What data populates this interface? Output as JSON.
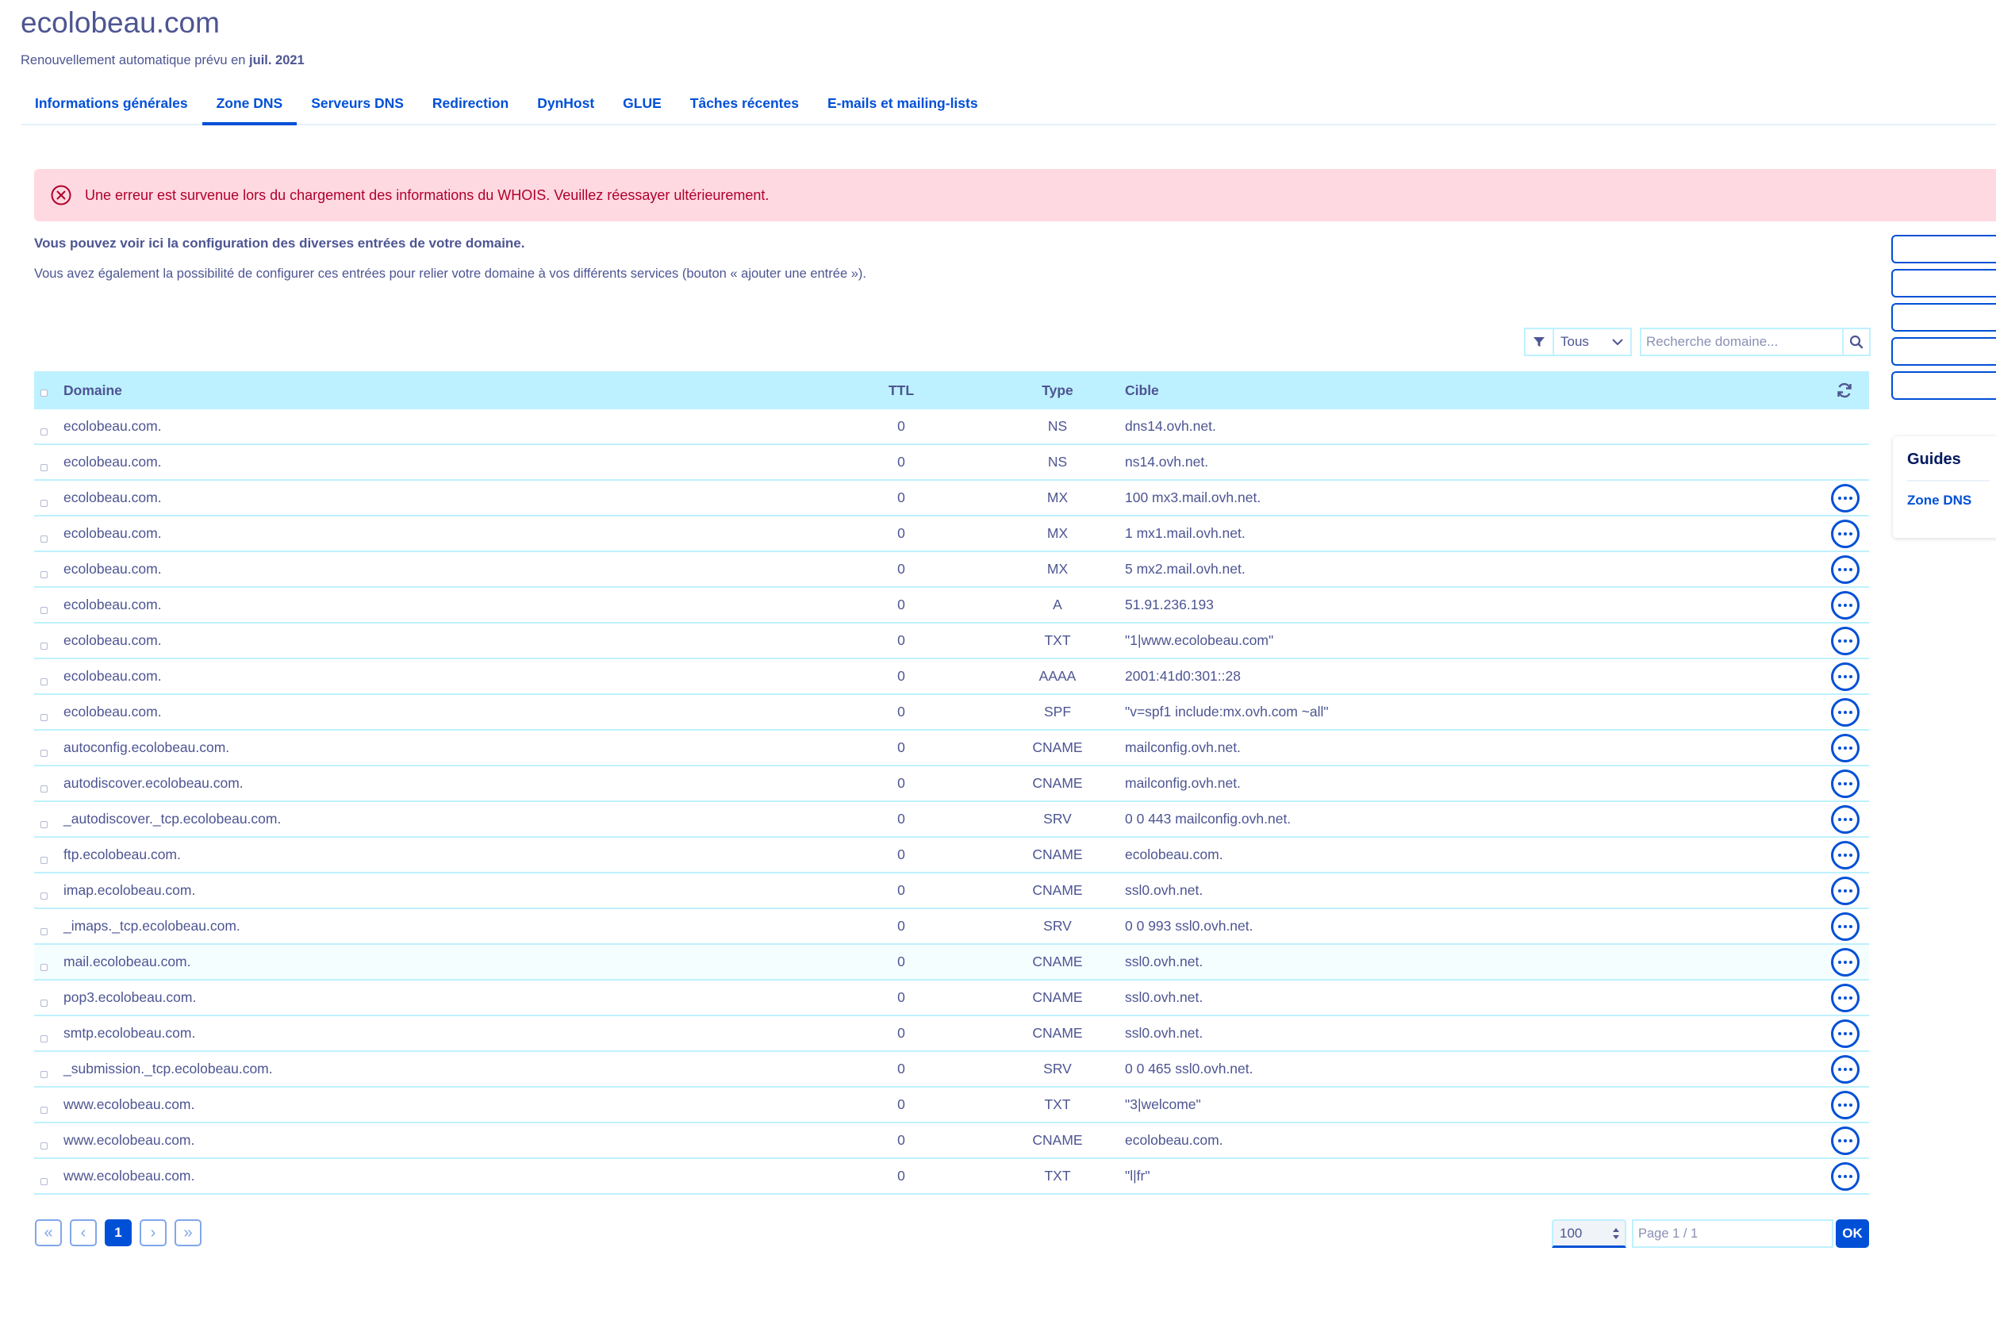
{
  "header": {
    "title": "ecolobeau.com",
    "renewal_prefix": "Renouvellement automatique prévu en",
    "renewal_date": "juil. 2021"
  },
  "tabs": [
    {
      "label": "Informations générales",
      "active": false
    },
    {
      "label": "Zone DNS",
      "active": true
    },
    {
      "label": "Serveurs DNS",
      "active": false
    },
    {
      "label": "Redirection",
      "active": false
    },
    {
      "label": "DynHost",
      "active": false
    },
    {
      "label": "GLUE",
      "active": false
    },
    {
      "label": "Tâches récentes",
      "active": false
    },
    {
      "label": "E-mails et mailing-lists",
      "active": false
    }
  ],
  "alert": {
    "message": "Une erreur est survenue lors du chargement des informations du WHOIS. Veuillez réessayer ultérieurement."
  },
  "intro": {
    "bold": "Vous pouvez voir ici la configuration des diverses entrées de votre domaine.",
    "text": "Vous avez également la possibilité de configurer ces entrées pour relier votre domaine à vos différents services (bouton « ajouter une entrée »)."
  },
  "filter": {
    "selected": "Tous",
    "search_placeholder": "Recherche domaine..."
  },
  "table": {
    "headers": {
      "domain": "Domaine",
      "ttl": "TTL",
      "type": "Type",
      "target": "Cible"
    },
    "rows": [
      {
        "domain": "ecolobeau.com.",
        "ttl": "0",
        "type": "NS",
        "target": "dns14.ovh.net.",
        "actions": false
      },
      {
        "domain": "ecolobeau.com.",
        "ttl": "0",
        "type": "NS",
        "target": "ns14.ovh.net.",
        "actions": false
      },
      {
        "domain": "ecolobeau.com.",
        "ttl": "0",
        "type": "MX",
        "target": "100 mx3.mail.ovh.net.",
        "actions": true
      },
      {
        "domain": "ecolobeau.com.",
        "ttl": "0",
        "type": "MX",
        "target": "1 mx1.mail.ovh.net.",
        "actions": true
      },
      {
        "domain": "ecolobeau.com.",
        "ttl": "0",
        "type": "MX",
        "target": "5 mx2.mail.ovh.net.",
        "actions": true
      },
      {
        "domain": "ecolobeau.com.",
        "ttl": "0",
        "type": "A",
        "target": "51.91.236.193",
        "actions": true
      },
      {
        "domain": "ecolobeau.com.",
        "ttl": "0",
        "type": "TXT",
        "target": "\"1|www.ecolobeau.com\"",
        "actions": true
      },
      {
        "domain": "ecolobeau.com.",
        "ttl": "0",
        "type": "AAAA",
        "target": "2001:41d0:301::28",
        "actions": true
      },
      {
        "domain": "ecolobeau.com.",
        "ttl": "0",
        "type": "SPF",
        "target": "\"v=spf1 include:mx.ovh.com ~all\"",
        "actions": true
      },
      {
        "domain": "autoconfig.ecolobeau.com.",
        "ttl": "0",
        "type": "CNAME",
        "target": "mailconfig.ovh.net.",
        "actions": true
      },
      {
        "domain": "autodiscover.ecolobeau.com.",
        "ttl": "0",
        "type": "CNAME",
        "target": "mailconfig.ovh.net.",
        "actions": true
      },
      {
        "domain": "_autodiscover._tcp.ecolobeau.com.",
        "ttl": "0",
        "type": "SRV",
        "target": "0 0 443 mailconfig.ovh.net.",
        "actions": true
      },
      {
        "domain": "ftp.ecolobeau.com.",
        "ttl": "0",
        "type": "CNAME",
        "target": "ecolobeau.com.",
        "actions": true
      },
      {
        "domain": "imap.ecolobeau.com.",
        "ttl": "0",
        "type": "CNAME",
        "target": "ssl0.ovh.net.",
        "actions": true
      },
      {
        "domain": "_imaps._tcp.ecolobeau.com.",
        "ttl": "0",
        "type": "SRV",
        "target": "0 0 993 ssl0.ovh.net.",
        "actions": true
      },
      {
        "domain": "mail.ecolobeau.com.",
        "ttl": "0",
        "type": "CNAME",
        "target": "ssl0.ovh.net.",
        "actions": true
      },
      {
        "domain": "pop3.ecolobeau.com.",
        "ttl": "0",
        "type": "CNAME",
        "target": "ssl0.ovh.net.",
        "actions": true
      },
      {
        "domain": "smtp.ecolobeau.com.",
        "ttl": "0",
        "type": "CNAME",
        "target": "ssl0.ovh.net.",
        "actions": true
      },
      {
        "domain": "_submission._tcp.ecolobeau.com.",
        "ttl": "0",
        "type": "SRV",
        "target": "0 0 465 ssl0.ovh.net.",
        "actions": true
      },
      {
        "domain": "www.ecolobeau.com.",
        "ttl": "0",
        "type": "TXT",
        "target": "\"3|welcome\"",
        "actions": true
      },
      {
        "domain": "www.ecolobeau.com.",
        "ttl": "0",
        "type": "CNAME",
        "target": "ecolobeau.com.",
        "actions": true
      },
      {
        "domain": "www.ecolobeau.com.",
        "ttl": "0",
        "type": "TXT",
        "target": "\"l|fr\"",
        "actions": true
      }
    ]
  },
  "guides": {
    "title": "Guides",
    "link": "Zone DNS"
  },
  "pagination": {
    "first": "«",
    "prev": "‹",
    "current": "1",
    "next": "›",
    "last": "»",
    "page_size": "100",
    "page_placeholder": "Page 1 / 1",
    "ok_label": "OK"
  },
  "colors": {
    "accent": "#0050d7",
    "text": "#4d5592",
    "header_bg": "#bef1ff",
    "alert_bg": "#ffd9e1",
    "alert_text": "#b0002b"
  }
}
